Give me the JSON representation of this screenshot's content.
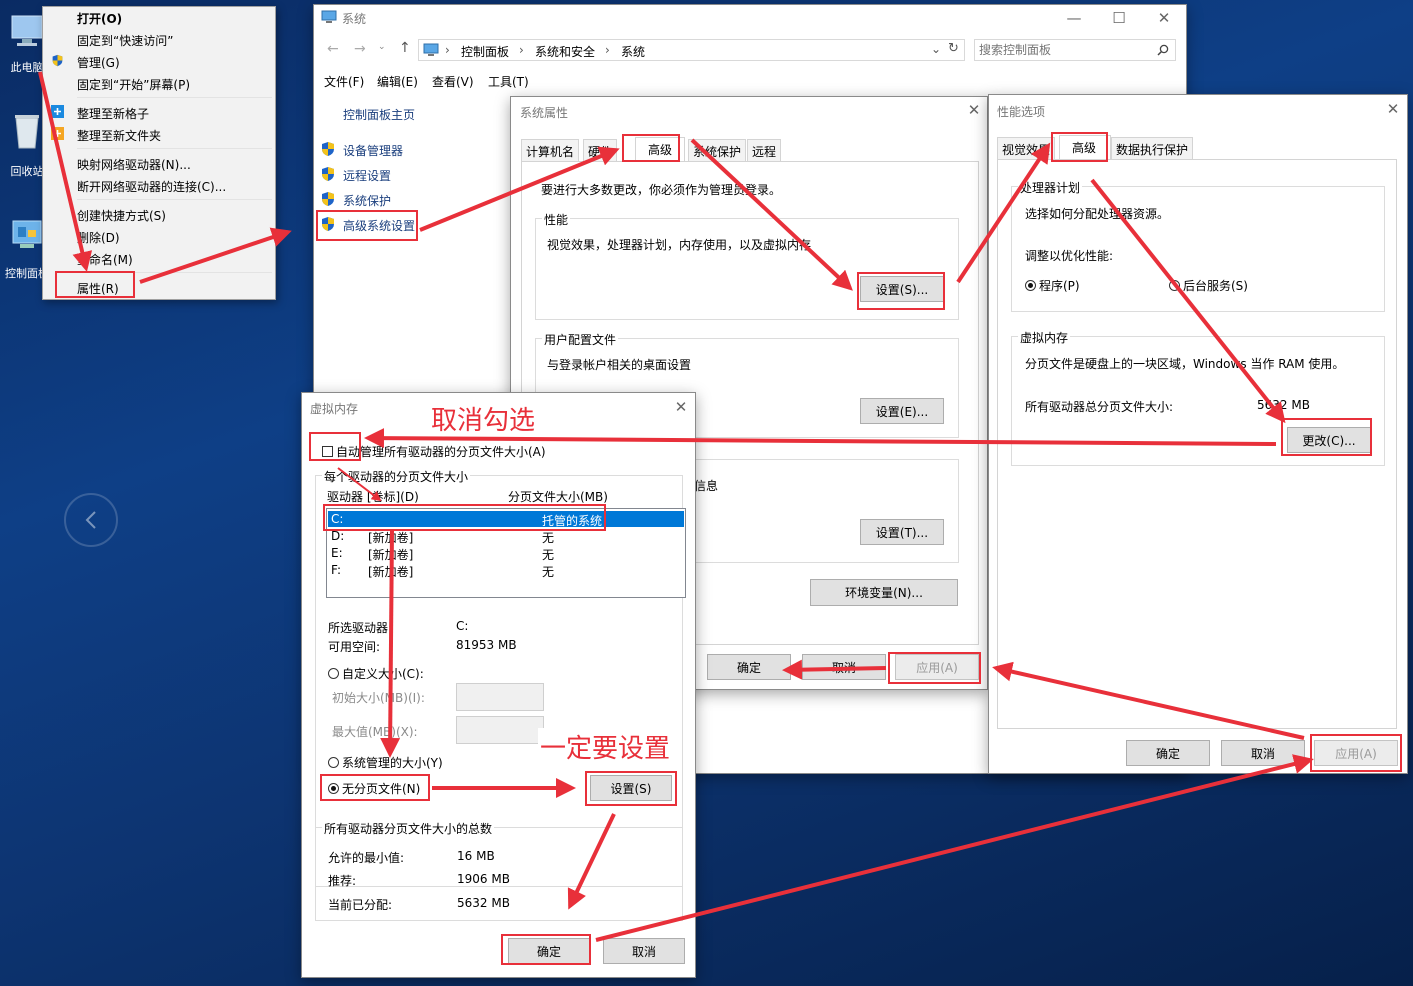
{
  "desktop": {
    "icons": [
      {
        "label": "此电脑"
      },
      {
        "label": "回收站"
      },
      {
        "label": "控制面板"
      }
    ],
    "nav_arrow": "chevron-left-icon"
  },
  "context_menu": {
    "items": [
      "打开(O)",
      "固定到“快速访问”",
      "管理(G)",
      "固定到“开始”屏幕(P)",
      "整理至新格子",
      "整理至新文件夹",
      "映射网络驱动器(N)...",
      "断开网络驱动器的连接(C)...",
      "创建快捷方式(S)",
      "删除(D)",
      "重命名(M)",
      "属性(R)"
    ]
  },
  "system_window": {
    "title": "系统",
    "breadcrumb": [
      "控制面板",
      "系统和安全",
      "系统"
    ],
    "search_placeholder": "搜索控制面板",
    "menu": [
      "文件(F)",
      "编辑(E)",
      "查看(V)",
      "工具(T)"
    ],
    "side_home": "控制面板主页",
    "side_links": [
      "设备管理器",
      "远程设置",
      "系统保护",
      "高级系统设置"
    ]
  },
  "sysprops": {
    "title": "系统属性",
    "tabs": [
      "计算机名",
      "硬件",
      "高级",
      "系统保护",
      "远程"
    ],
    "admin_note": "要进行大多数更改，你必须作为管理员登录。",
    "perf_title": "性能",
    "perf_desc": "视觉效果，处理器计划，内存使用，以及虚拟内存",
    "settings_btn": "设置(S)...",
    "profile_title": "用户配置文件",
    "profile_desc": "与登录帐户相关的桌面设置",
    "profile_btn": "设置(E)...",
    "startup_partial": "信息",
    "startup_btn": "设置(T)...",
    "env_btn": "环境变量(N)...",
    "ok": "确定",
    "cancel": "取消",
    "apply": "应用(A)"
  },
  "perfopts": {
    "title": "性能选项",
    "tabs": [
      "视觉效果",
      "高级",
      "数据执行保护"
    ],
    "sched_title": "处理器计划",
    "sched_desc": "选择如何分配处理器资源。",
    "adjust": "调整以优化性能:",
    "radio_programs": "程序(P)",
    "radio_bg": "后台服务(S)",
    "vm_title": "虚拟内存",
    "vm_desc": "分页文件是硬盘上的一块区域，Windows 当作 RAM 使用。",
    "vm_total_label": "所有驱动器总分页文件大小:",
    "vm_total_value": "5632 MB",
    "change_btn": "更改(C)...",
    "ok": "确定",
    "cancel": "取消",
    "apply": "应用(A)"
  },
  "vmem": {
    "title": "虚拟内存",
    "auto_manage": "自动管理所有驱动器的分页文件大小(A)",
    "per_drive_title": "每个驱动器的分页文件大小",
    "col_drive": "驱动器 [卷标](D)",
    "col_size": "分页文件大小(MB)",
    "drives": [
      {
        "letter": "C:",
        "label": "",
        "size": "托管的系统"
      },
      {
        "letter": "D:",
        "label": "[新加卷]",
        "size": "无"
      },
      {
        "letter": "E:",
        "label": "[新加卷]",
        "size": "无"
      },
      {
        "letter": "F:",
        "label": "[新加卷]",
        "size": "无"
      }
    ],
    "selected_label": "所选驱动器:",
    "selected_value": "C:",
    "free_label": "可用空间:",
    "free_value": "81953 MB",
    "custom": "自定义大小(C):",
    "init_size": "初始大小(MB)(I):",
    "max_size": "最大值(MB)(X):",
    "system_managed": "系统管理的大小(Y)",
    "no_paging": "无分页文件(N)",
    "set_btn": "设置(S)",
    "totals_title": "所有驱动器分页文件大小的总数",
    "min_label": "允许的最小值:",
    "min_value": "16 MB",
    "rec_label": "推荐:",
    "rec_value": "1906 MB",
    "cur_label": "当前已分配:",
    "cur_value": "5632 MB",
    "ok": "确定",
    "cancel": "取消"
  },
  "annotations": {
    "uncheck": "取消勾选",
    "must_set": "一定要设置"
  },
  "colors": {
    "highlight": "#e8303a",
    "selection": "#0078d7",
    "shield_blue": "#1e64c8",
    "shield_yellow": "#f3c21b"
  }
}
